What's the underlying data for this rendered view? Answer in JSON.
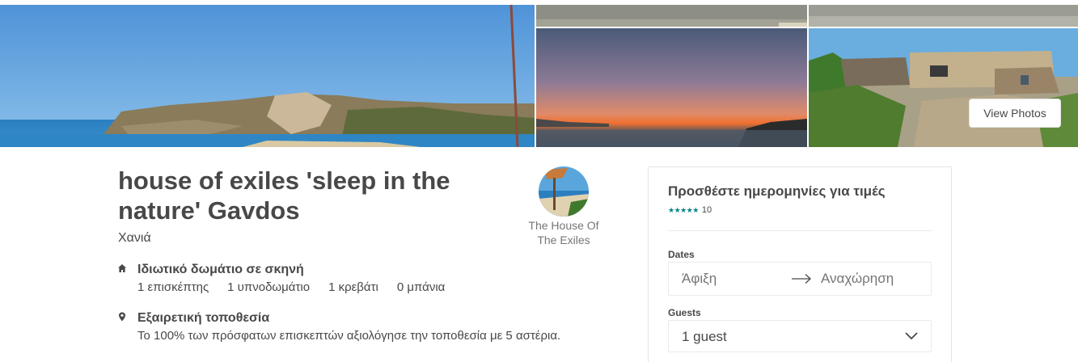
{
  "gallery": {
    "view_photos_label": "View Photos"
  },
  "listing": {
    "title": "house of exiles 'sleep in the nature' Gavdos",
    "city": "Χανιά"
  },
  "host": {
    "name": "The House Of The Exiles"
  },
  "features": [
    {
      "icon": "home-icon",
      "title": "Ιδιωτικό δωμάτιο σε σκηνή",
      "details": [
        "1 επισκέπτης",
        "1 υπνοδωμάτιο",
        "1 κρεβάτι",
        "0 μπάνια"
      ]
    },
    {
      "icon": "location-pin-icon",
      "title": "Εξαιρετική τοποθεσία",
      "description": "Το 100% των πρόσφατων επισκεπτών αξιολόγησε την τοποθεσία με 5 αστέρια."
    }
  ],
  "booking": {
    "title": "Προσθέστε ημερομηνίες για τιμές",
    "stars": "★★★★★",
    "rating_value": 5,
    "review_count": "10",
    "dates_label": "Dates",
    "checkin_placeholder": "Άφιξη",
    "checkout_placeholder": "Αναχώρηση",
    "guests_label": "Guests",
    "guests_value": "1 guest"
  },
  "colors": {
    "accent": "#008489",
    "text": "#484848",
    "muted": "#767676",
    "border": "#ebebeb"
  }
}
